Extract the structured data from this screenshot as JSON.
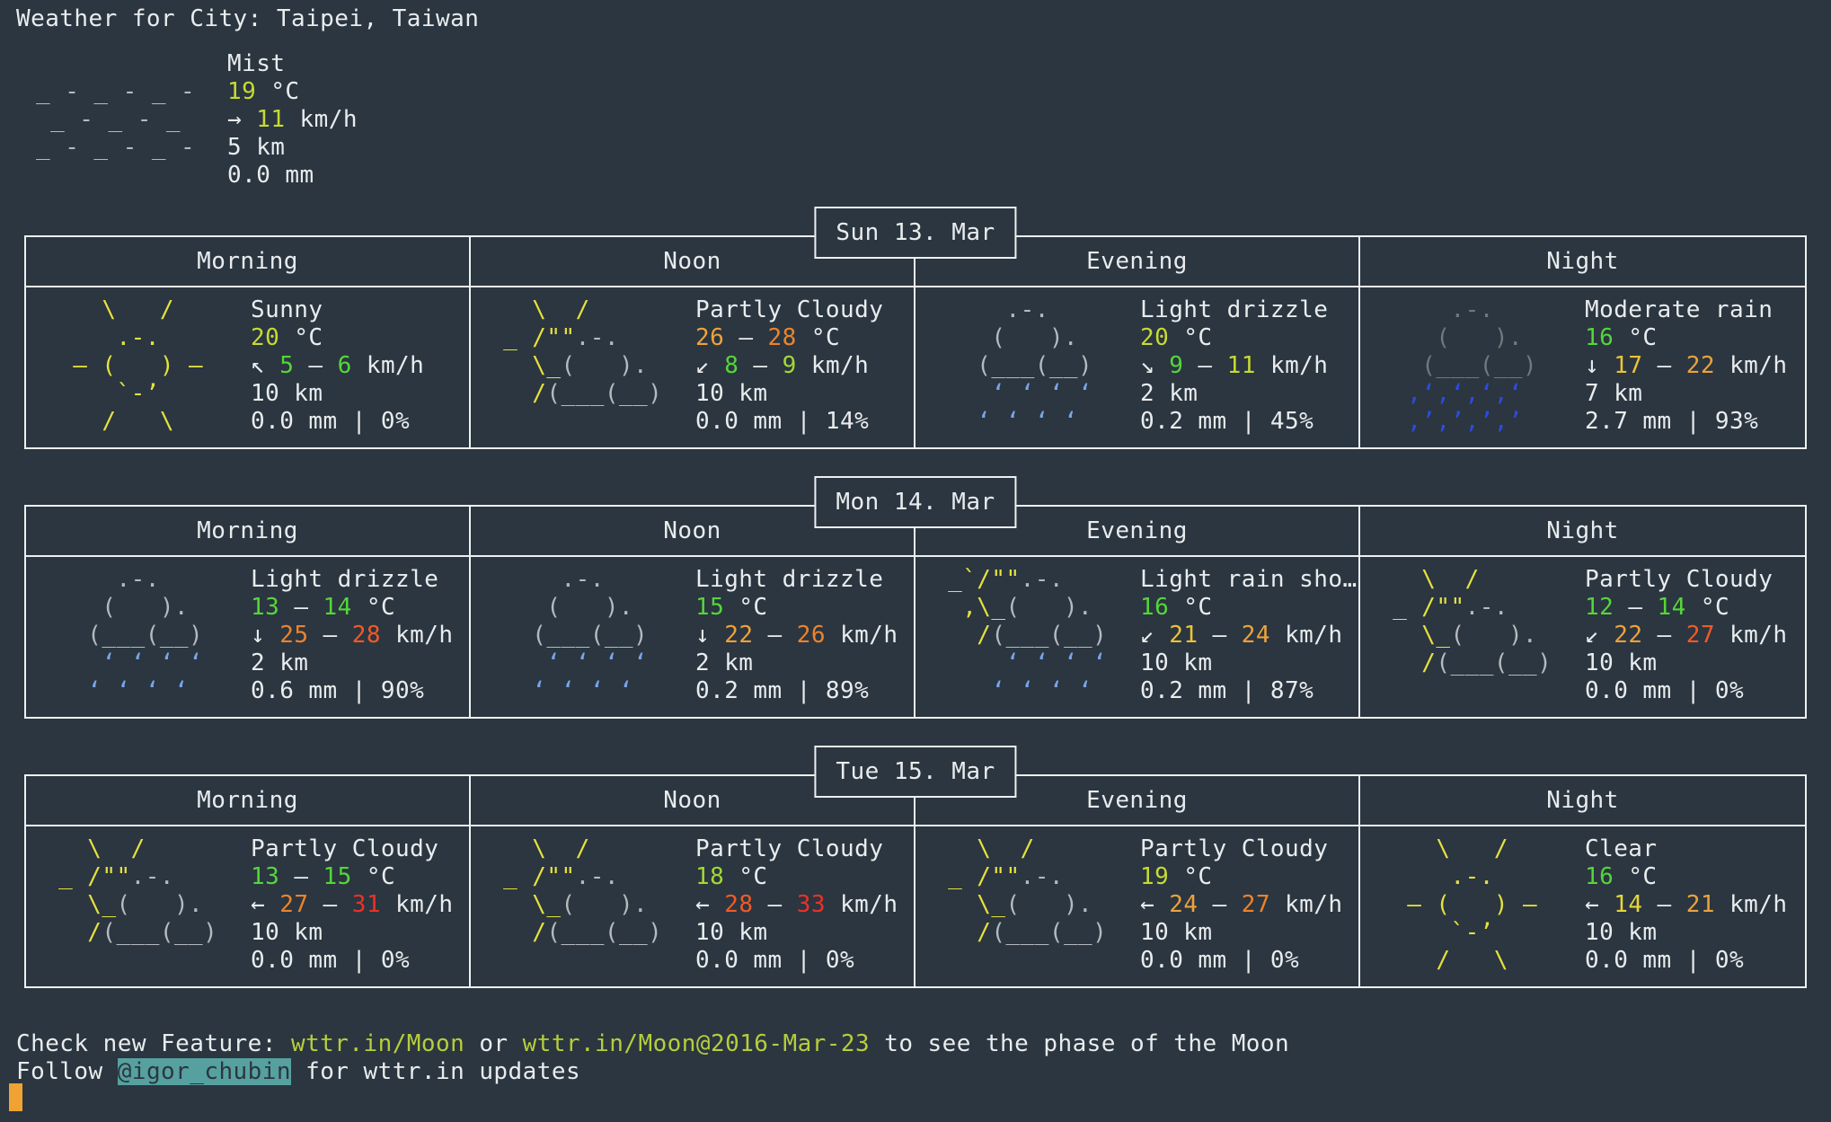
{
  "title": "Weather for City: Taipei, Taiwan",
  "palette": {
    "bg": "#2b3640",
    "fg": "#e9ecee",
    "gray": "#b4babf",
    "darkgray": "#72787d",
    "yellow": "#e6e13e",
    "lime": "#c7da33",
    "greenYellow": "#a4d834",
    "green": "#55d63a",
    "windYellow": "#e8d43a",
    "amber": "#ecc23a",
    "orange": "#eda23a",
    "darkOrange": "#ec832c",
    "redOrange": "#f05a27",
    "red": "#ee3026",
    "blue": "#7aa5e8",
    "deepblue": "#2c4be8",
    "teal": "#56a1a0",
    "link": "#b7cd3c",
    "cursor": "#f0a233",
    "border": "#edf0f2"
  },
  "icons": {
    "mist": [
      [
        [
          " ",
          "gray"
        ]
      ],
      [
        [
          "_ - _ - _ - ",
          "gray"
        ]
      ],
      [
        [
          " _ - _ - _  ",
          "gray"
        ]
      ],
      [
        [
          "_ - _ - _ - ",
          "gray"
        ]
      ]
    ],
    "sunny": [
      [
        [
          "    \\   /    ",
          "yellow"
        ]
      ],
      [
        [
          "     .-.     ",
          "yellow"
        ]
      ],
      [
        [
          "  ― (   ) ―  ",
          "yellow"
        ]
      ],
      [
        [
          "     `-’     ",
          "yellow"
        ]
      ],
      [
        [
          "    /   \\    ",
          "yellow"
        ]
      ]
    ],
    "partly_cloudy": [
      [
        [
          "   \\  /",
          "yellow"
        ]
      ],
      [
        [
          " _ /\"\"",
          "yellow"
        ],
        [
          ".-.",
          "gray"
        ]
      ],
      [
        [
          "   \\_",
          "yellow"
        ],
        [
          "(   ).",
          "gray"
        ]
      ],
      [
        [
          "   /",
          "yellow"
        ],
        [
          "(___(__)",
          "gray"
        ]
      ],
      [
        [
          " ",
          "gray"
        ]
      ]
    ],
    "light_drizzle": [
      [
        [
          "     .-.",
          "gray"
        ]
      ],
      [
        [
          "    (   ).",
          "gray"
        ]
      ],
      [
        [
          "   (___(__)",
          "gray"
        ]
      ],
      [
        [
          "    ‘ ‘ ‘ ‘",
          "blue"
        ]
      ],
      [
        [
          "   ‘ ‘ ‘ ‘",
          "blue"
        ]
      ]
    ],
    "moderate_rain": [
      [
        [
          "     .-.",
          "darkgray"
        ]
      ],
      [
        [
          "    (   ).",
          "darkgray"
        ]
      ],
      [
        [
          "   (___(__)",
          "darkgray"
        ]
      ],
      [
        [
          "  ‚‘‚‘‚‘‚‘",
          "deepblue"
        ]
      ],
      [
        [
          "  ‚’‚’‚’‚’",
          "deepblue"
        ]
      ]
    ],
    "light_rain_shower": [
      [
        [
          " _`/\"\"",
          "yellow"
        ],
        [
          ".-.",
          "gray"
        ]
      ],
      [
        [
          "  ,\\_",
          "yellow"
        ],
        [
          "(   ).",
          "gray"
        ]
      ],
      [
        [
          "   /",
          "yellow"
        ],
        [
          "(___(__)",
          "gray"
        ]
      ],
      [
        [
          "     ‘ ‘ ‘ ‘",
          "blue"
        ]
      ],
      [
        [
          "    ‘ ‘ ‘ ‘",
          "blue"
        ]
      ]
    ]
  },
  "current": {
    "icon": "mist",
    "lines": [
      [
        [
          "Mist",
          "fg"
        ]
      ],
      [
        [
          "19",
          "lime"
        ],
        [
          " °C",
          "fg"
        ]
      ],
      [
        [
          "→ ",
          "fg"
        ],
        [
          "11",
          "lime"
        ],
        [
          " km/h",
          "fg"
        ]
      ],
      [
        [
          "5 km",
          "fg"
        ]
      ],
      [
        [
          "0.0 mm",
          "fg"
        ]
      ]
    ]
  },
  "columns": [
    "Morning",
    "Noon",
    "Evening",
    "Night"
  ],
  "days": [
    {
      "date": "Sun 13. Mar",
      "cells": [
        {
          "icon": "sunny",
          "lines": [
            [
              [
                "Sunny",
                "fg"
              ]
            ],
            [
              [
                "20",
                "lime"
              ],
              [
                " °C",
                "fg"
              ]
            ],
            [
              [
                "↖ ",
                "fg"
              ],
              [
                "5",
                "green"
              ],
              [
                " – ",
                "fg"
              ],
              [
                "6",
                "green"
              ],
              [
                " km/h",
                "fg"
              ]
            ],
            [
              [
                "10 km",
                "fg"
              ]
            ],
            [
              [
                "0.0 mm | 0%",
                "fg"
              ]
            ]
          ]
        },
        {
          "icon": "partly_cloudy",
          "lines": [
            [
              [
                "Partly Cloudy",
                "fg"
              ]
            ],
            [
              [
                "26",
                "orange"
              ],
              [
                " – ",
                "fg"
              ],
              [
                "28",
                "darkOrange"
              ],
              [
                " °C",
                "fg"
              ]
            ],
            [
              [
                "↙ ",
                "fg"
              ],
              [
                "8",
                "green"
              ],
              [
                " – ",
                "fg"
              ],
              [
                "9",
                "greenYellow"
              ],
              [
                " km/h",
                "fg"
              ]
            ],
            [
              [
                "10 km",
                "fg"
              ]
            ],
            [
              [
                "0.0 mm | 14%",
                "fg"
              ]
            ]
          ]
        },
        {
          "icon": "light_drizzle",
          "lines": [
            [
              [
                "Light drizzle",
                "fg"
              ]
            ],
            [
              [
                "20",
                "lime"
              ],
              [
                " °C",
                "fg"
              ]
            ],
            [
              [
                "↘ ",
                "fg"
              ],
              [
                "9",
                "green"
              ],
              [
                " – ",
                "fg"
              ],
              [
                "11",
                "lime"
              ],
              [
                " km/h",
                "fg"
              ]
            ],
            [
              [
                "2 km",
                "fg"
              ]
            ],
            [
              [
                "0.2 mm | 45%",
                "fg"
              ]
            ]
          ]
        },
        {
          "icon": "moderate_rain",
          "lines": [
            [
              [
                "Moderate rain",
                "fg"
              ]
            ],
            [
              [
                "16",
                "green"
              ],
              [
                " °C",
                "fg"
              ]
            ],
            [
              [
                "↓ ",
                "fg"
              ],
              [
                "17",
                "amber"
              ],
              [
                " – ",
                "fg"
              ],
              [
                "22",
                "orange"
              ],
              [
                " km/h",
                "fg"
              ]
            ],
            [
              [
                "7 km",
                "fg"
              ]
            ],
            [
              [
                "2.7 mm | 93%",
                "fg"
              ]
            ]
          ]
        }
      ]
    },
    {
      "date": "Mon 14. Mar",
      "cells": [
        {
          "icon": "light_drizzle",
          "lines": [
            [
              [
                "Light drizzle",
                "fg"
              ]
            ],
            [
              [
                "13",
                "green"
              ],
              [
                " – ",
                "fg"
              ],
              [
                "14",
                "green"
              ],
              [
                " °C",
                "fg"
              ]
            ],
            [
              [
                "↓ ",
                "fg"
              ],
              [
                "25",
                "darkOrange"
              ],
              [
                " – ",
                "fg"
              ],
              [
                "28",
                "redOrange"
              ],
              [
                " km/h",
                "fg"
              ]
            ],
            [
              [
                "2 km",
                "fg"
              ]
            ],
            [
              [
                "0.6 mm | 90%",
                "fg"
              ]
            ]
          ]
        },
        {
          "icon": "light_drizzle",
          "lines": [
            [
              [
                "Light drizzle",
                "fg"
              ]
            ],
            [
              [
                "15",
                "green"
              ],
              [
                " °C",
                "fg"
              ]
            ],
            [
              [
                "↓ ",
                "fg"
              ],
              [
                "22",
                "orange"
              ],
              [
                " – ",
                "fg"
              ],
              [
                "26",
                "darkOrange"
              ],
              [
                " km/h",
                "fg"
              ]
            ],
            [
              [
                "2 km",
                "fg"
              ]
            ],
            [
              [
                "0.2 mm | 89%",
                "fg"
              ]
            ]
          ]
        },
        {
          "icon": "light_rain_shower",
          "lines": [
            [
              [
                "Light rain sho…",
                "fg"
              ]
            ],
            [
              [
                "16",
                "green"
              ],
              [
                " °C",
                "fg"
              ]
            ],
            [
              [
                "↙ ",
                "fg"
              ],
              [
                "21",
                "amber"
              ],
              [
                " – ",
                "fg"
              ],
              [
                "24",
                "orange"
              ],
              [
                " km/h",
                "fg"
              ]
            ],
            [
              [
                "10 km",
                "fg"
              ]
            ],
            [
              [
                "0.2 mm | 87%",
                "fg"
              ]
            ]
          ]
        },
        {
          "icon": "partly_cloudy",
          "lines": [
            [
              [
                "Partly Cloudy",
                "fg"
              ]
            ],
            [
              [
                "12",
                "green"
              ],
              [
                " – ",
                "fg"
              ],
              [
                "14",
                "green"
              ],
              [
                " °C",
                "fg"
              ]
            ],
            [
              [
                "↙ ",
                "fg"
              ],
              [
                "22",
                "orange"
              ],
              [
                " – ",
                "fg"
              ],
              [
                "27",
                "redOrange"
              ],
              [
                " km/h",
                "fg"
              ]
            ],
            [
              [
                "10 km",
                "fg"
              ]
            ],
            [
              [
                "0.0 mm | 0%",
                "fg"
              ]
            ]
          ]
        }
      ]
    },
    {
      "date": "Tue 15. Mar",
      "cells": [
        {
          "icon": "partly_cloudy",
          "lines": [
            [
              [
                "Partly Cloudy",
                "fg"
              ]
            ],
            [
              [
                "13",
                "green"
              ],
              [
                " – ",
                "fg"
              ],
              [
                "15",
                "green"
              ],
              [
                " °C",
                "fg"
              ]
            ],
            [
              [
                "← ",
                "fg"
              ],
              [
                "27",
                "darkOrange"
              ],
              [
                " – ",
                "fg"
              ],
              [
                "31",
                "red"
              ],
              [
                " km/h",
                "fg"
              ]
            ],
            [
              [
                "10 km",
                "fg"
              ]
            ],
            [
              [
                "0.0 mm | 0%",
                "fg"
              ]
            ]
          ]
        },
        {
          "icon": "partly_cloudy",
          "lines": [
            [
              [
                "Partly Cloudy",
                "fg"
              ]
            ],
            [
              [
                "18",
                "greenYellow"
              ],
              [
                " °C",
                "fg"
              ]
            ],
            [
              [
                "← ",
                "fg"
              ],
              [
                "28",
                "redOrange"
              ],
              [
                " – ",
                "fg"
              ],
              [
                "33",
                "red"
              ],
              [
                " km/h",
                "fg"
              ]
            ],
            [
              [
                "10 km",
                "fg"
              ]
            ],
            [
              [
                "0.0 mm | 0%",
                "fg"
              ]
            ]
          ]
        },
        {
          "icon": "partly_cloudy",
          "lines": [
            [
              [
                "Partly Cloudy",
                "fg"
              ]
            ],
            [
              [
                "19",
                "lime"
              ],
              [
                " °C",
                "fg"
              ]
            ],
            [
              [
                "← ",
                "fg"
              ],
              [
                "24",
                "orange"
              ],
              [
                " – ",
                "fg"
              ],
              [
                "27",
                "darkOrange"
              ],
              [
                " km/h",
                "fg"
              ]
            ],
            [
              [
                "10 km",
                "fg"
              ]
            ],
            [
              [
                "0.0 mm | 0%",
                "fg"
              ]
            ]
          ]
        },
        {
          "icon": "sunny",
          "lines": [
            [
              [
                "Clear",
                "fg"
              ]
            ],
            [
              [
                "16",
                "green"
              ],
              [
                " °C",
                "fg"
              ]
            ],
            [
              [
                "← ",
                "fg"
              ],
              [
                "14",
                "windYellow"
              ],
              [
                " – ",
                "fg"
              ],
              [
                "21",
                "orange"
              ],
              [
                " km/h",
                "fg"
              ]
            ],
            [
              [
                "10 km",
                "fg"
              ]
            ],
            [
              [
                "0.0 mm | 0%",
                "fg"
              ]
            ]
          ]
        }
      ]
    }
  ],
  "footer": {
    "line1": [
      [
        "Check new Feature: ",
        "fg"
      ],
      [
        "wttr.in/Moon",
        "link",
        "moon-link",
        true
      ],
      [
        " or ",
        "fg"
      ],
      [
        "wttr.in/Moon@2016-Mar-23",
        "link",
        "moon-date-link",
        true
      ],
      [
        " to see the phase of the Moon",
        "fg"
      ]
    ],
    "line2": [
      [
        "Follow ",
        "fg"
      ],
      [
        "@igor_chubin",
        "inverse",
        "igor-chubin-handle",
        true
      ],
      [
        " for wttr.in updates",
        "fg"
      ]
    ]
  }
}
